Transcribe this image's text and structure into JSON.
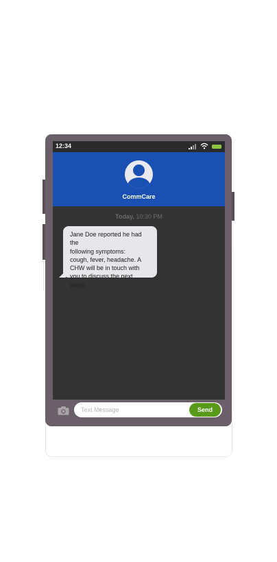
{
  "status_bar": {
    "time": "12:34"
  },
  "header": {
    "contact_name": "CommCare"
  },
  "conversation": {
    "timestamp_day": "Today,",
    "timestamp_time": "10:30 PM",
    "messages": [
      {
        "lines": [
          "Jane Doe reported he had the",
          "following symptoms:",
          "cough, fever, headache. A",
          "CHW will be in touch with",
          "you to discuss the next steps."
        ]
      }
    ]
  },
  "composer": {
    "placeholder": "Text Message",
    "send_label": "Send"
  },
  "colors": {
    "header_blue": "#1a4fb4",
    "send_green": "#5a9a1a",
    "phone_frame": "#6b5f69",
    "screen_bg": "#333333",
    "bubble_bg": "#e6e6eb"
  },
  "icons": [
    "signal-icon",
    "wifi-icon",
    "battery-icon",
    "person-avatar-icon",
    "camera-icon"
  ]
}
